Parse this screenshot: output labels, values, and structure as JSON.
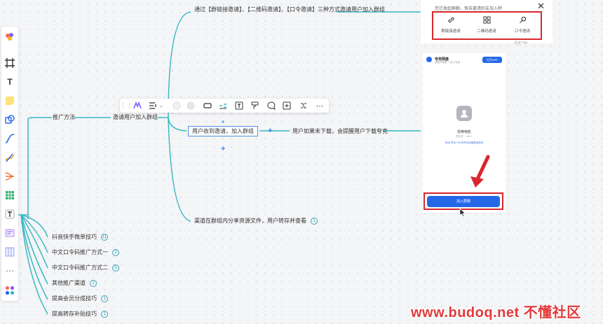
{
  "colors": {
    "branch": "#3bb8c4",
    "selection": "#4e8fe0",
    "highlight": "#d9262c",
    "primary": "#2468e8",
    "watermark": "#e23a3a"
  },
  "left_toolbar": {
    "icons": [
      "brand-palette-icon",
      "frame-icon",
      "text-icon",
      "sticky-note-icon",
      "shape-icon",
      "connector-icon",
      "pen-icon",
      "mindmap-icon",
      "table-icon",
      "text-block-icon",
      "card-icon",
      "kanban-icon",
      "more-icon",
      "apps-icon"
    ],
    "text_label": "T"
  },
  "mindmap": {
    "root_label": "推广方法",
    "invite_label": "邀请用户加入群组",
    "invite_children": {
      "methods": "通过【群链接邀请】、【二维码邀请】、【口令邀请】三种方式邀请用户加入群组",
      "received": "用户收到邀请，加入群组",
      "download_hint": "用户如果未下载，会提醒用户下载夸克",
      "share": "渠道在群组内分享资源文件，用户转存并查看",
      "share_count": "1"
    },
    "other_children": [
      {
        "label": "抖音快手微单技巧",
        "count": "11"
      },
      {
        "label": "中文口令码推广方式一",
        "count": "2"
      },
      {
        "label": "中文口令码推广方式二",
        "count": "5"
      },
      {
        "label": "其他推广渠道",
        "count": "1"
      },
      {
        "label": "提高会员分成技巧",
        "count": "1"
      },
      {
        "label": "提高转存补贴技巧",
        "count": "1"
      }
    ]
  },
  "float_toolbar": {
    "icons": [
      "drag-handle-icon",
      "ai-icon",
      "layout-icon",
      "chevron-down-icon",
      "fill-color-icon",
      "border-color-icon",
      "rectangle-shape-icon",
      "line-style-icon",
      "text-format-icon",
      "format-painter-icon",
      "comment-icon",
      "insert-icon",
      "link-icon",
      "more-icon"
    ]
  },
  "invite_panel": {
    "title": "您已发起群聊，快去邀请好友加入吧",
    "options": [
      {
        "icon": "link-icon",
        "label": "群链接邀请"
      },
      {
        "icon": "qrcode-icon",
        "label": "二维码邀请"
      },
      {
        "icon": "key-icon",
        "label": "口令邀请"
      }
    ],
    "faint_text": "夸克**45"
  },
  "phone": {
    "brand": "夸克网盘",
    "subtitle": "智能AI搜索 · 1亿人在用",
    "open_button": "打开APP",
    "group_name": "恐怖电影",
    "members": "群成员 · 108人",
    "invite_text": "来自“夸克**45”的夸克网盘群组邀请",
    "join_button": "加入群聊"
  },
  "watermark": "www.budoq.net 不懂社区"
}
